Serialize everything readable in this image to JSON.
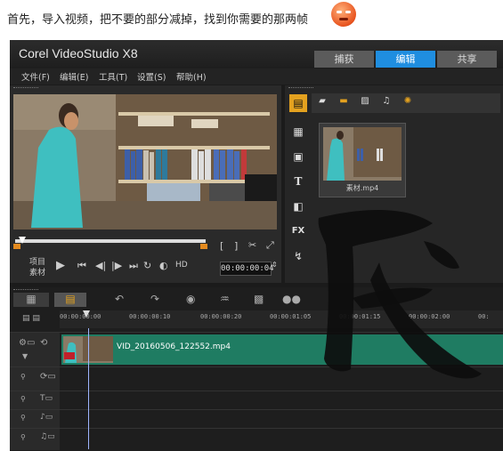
{
  "caption": "首先，导入视频，把不要的部分减掉，找到你需要的那两帧",
  "app": {
    "title": "Corel VideoStudio X8",
    "tabs": [
      {
        "label": "捕获",
        "active": false
      },
      {
        "label": "编辑",
        "active": true
      },
      {
        "label": "共享",
        "active": false
      }
    ],
    "menu": [
      "文件(F)",
      "编辑(E)",
      "工具(T)",
      "设置(S)",
      "帮助(H)"
    ]
  },
  "player": {
    "mode_project": "项目",
    "mode_clip": "素材",
    "hd_label": "HD",
    "timecode": "00:00:00:04",
    "trim_left": "[",
    "trim_right": "]"
  },
  "library": {
    "thumb_label": "素材.mp4",
    "fx_label": "FX"
  },
  "timeline": {
    "ruler_ticks": [
      "00:00:00:00",
      "00:00:00:10",
      "00:00:00:20",
      "00:00:01:05",
      "00:00:01:15",
      "00:00:02:00",
      "00:"
    ],
    "clip_label": "VID_20160506_122552.mp4"
  },
  "colors": {
    "accent_tab": "#1f8ee0",
    "clip_fill": "#1f7c62",
    "background": "#1b1b1b"
  }
}
